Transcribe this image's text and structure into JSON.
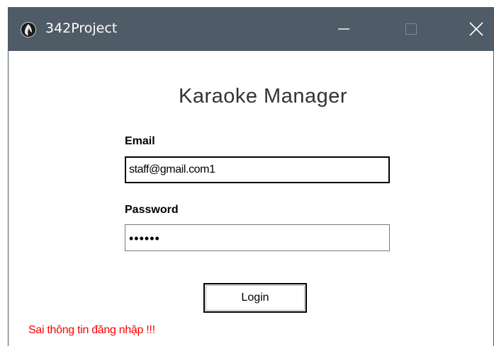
{
  "window": {
    "title": "342Project",
    "icon": "app-icon",
    "controls": {
      "minimize_icon": "minimize-icon",
      "maximize_icon": "maximize-icon",
      "close_icon": "close-icon"
    },
    "titlebar_color": "#4f5b66"
  },
  "form": {
    "heading": "Karaoke Manager",
    "email_label": "Email",
    "email_value": "staff@gmail.com1",
    "password_label": "Password",
    "password_masked": "••••••",
    "login_label": "Login",
    "error_message": "Sai thông tin đăng nhập !!!",
    "error_color": "#ff0000"
  }
}
